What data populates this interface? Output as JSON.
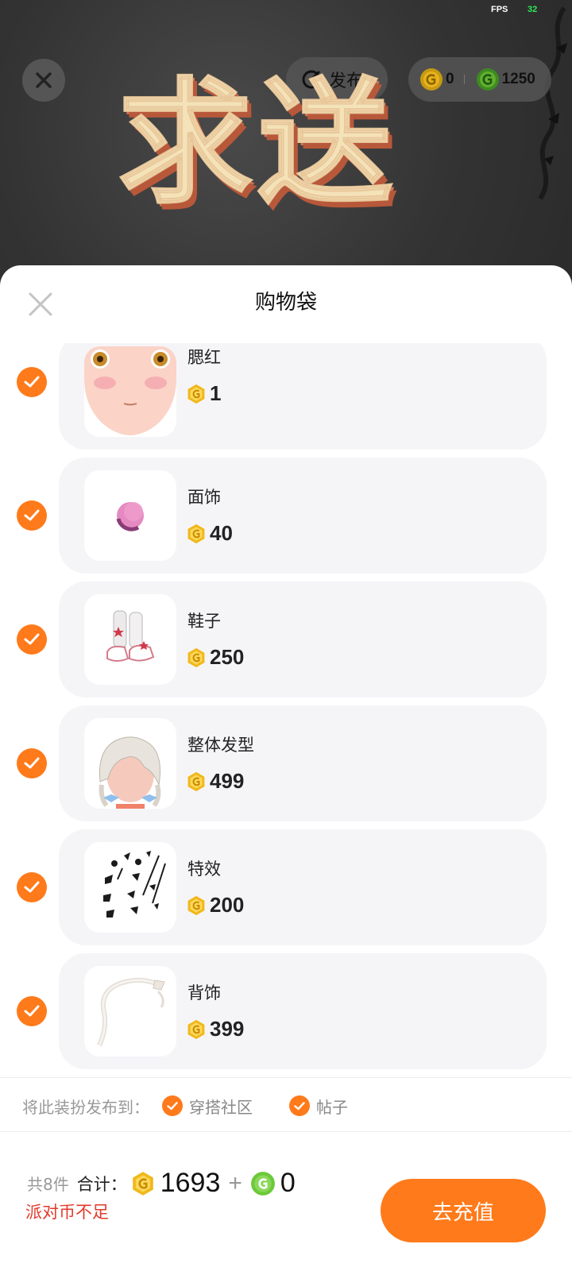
{
  "status": {
    "fps_label": "FPS",
    "fps_value": "32"
  },
  "top_bar": {
    "publish_label": "发布",
    "gold_balance": "0",
    "green_balance": "1250",
    "banner_text": "求送"
  },
  "sheet": {
    "title": "购物袋",
    "items": [
      {
        "name": "腮红",
        "price": "1",
        "icon": "blush-thumbnail"
      },
      {
        "name": "面饰",
        "price": "40",
        "icon": "face-accessory-thumbnail"
      },
      {
        "name": "鞋子",
        "price": "250",
        "icon": "shoes-thumbnail"
      },
      {
        "name": "整体发型",
        "price": "499",
        "icon": "hairstyle-thumbnail"
      },
      {
        "name": "特效",
        "price": "200",
        "icon": "effect-thumbnail"
      },
      {
        "name": "背饰",
        "price": "399",
        "icon": "back-accessory-thumbnail"
      }
    ],
    "publish_to": {
      "label": "将此装扮发布到：",
      "options": [
        "穿搭社区",
        "帖子"
      ]
    }
  },
  "footer": {
    "count_text": "共8件",
    "total_label": "合计：",
    "gold_total": "1693",
    "plus": "+",
    "green_total": "0",
    "warning": "派对币不足",
    "recharge_label": "去充值"
  },
  "colors": {
    "accent": "#ff7a1a",
    "gold_coin": "#f1b81b",
    "green_coin": "#6cc93a",
    "warning": "#e23a2b"
  }
}
